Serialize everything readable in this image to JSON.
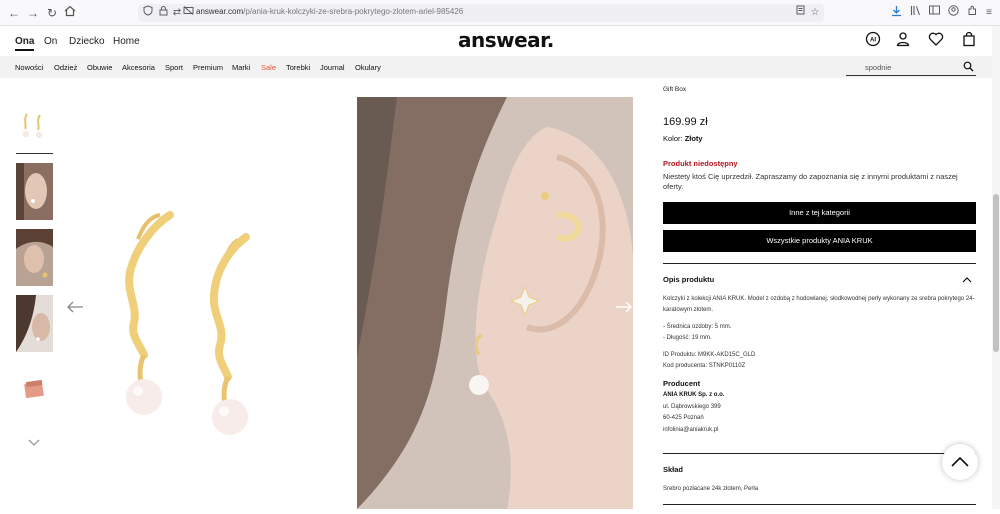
{
  "browser": {
    "url_domain": "answear.com",
    "url_path": "/p/ania-kruk-kolczyki-ze-srebra-pokrytego-zlotem-ariel-985426"
  },
  "header": {
    "gender_tabs": [
      {
        "label": "Ona",
        "active": true
      },
      {
        "label": "On",
        "active": false
      },
      {
        "label": "Dziecko",
        "active": false
      },
      {
        "label": "Home",
        "active": false
      }
    ],
    "logo": "answear.",
    "icons": [
      "ai-assistant-icon",
      "account-icon",
      "wishlist-heart-icon",
      "cart-bag-icon"
    ]
  },
  "categories": [
    {
      "label": "Nowości",
      "sale": false
    },
    {
      "label": "Odzież",
      "sale": false
    },
    {
      "label": "Obuwie",
      "sale": false
    },
    {
      "label": "Akcesoria",
      "sale": false
    },
    {
      "label": "Sport",
      "sale": false
    },
    {
      "label": "Premium",
      "sale": false
    },
    {
      "label": "Marki",
      "sale": false
    },
    {
      "label": "Sale",
      "sale": true
    },
    {
      "label": "Torebki",
      "sale": false
    },
    {
      "label": "Journal",
      "sale": false
    },
    {
      "label": "Okulary",
      "sale": false
    }
  ],
  "search": {
    "placeholder": "spodnie"
  },
  "product": {
    "gift_box": "Gift Box",
    "price": "169.99 zł",
    "color_label": "Kolor:",
    "color_value": "Złoty",
    "unavailable_title": "Produkt niedostępny",
    "unavailable_text": "Niestety ktoś Cię uprzedził. Zapraszamy do zapoznania się z innymi produktami z naszej oferty.",
    "btn_other_category": "Inne z tej kategorii",
    "btn_all_products": "Wszystkie produkty ANIA KRUK"
  },
  "description": {
    "title": "Opis produktu",
    "intro": "Kolczyki z kolekcji ANIA KRUK. Model z ozdobą z hodowlanej, słodkowodnej perły wykonany ze srebra pokrytego 24-karatowym złotem.",
    "spec_1": "- Średnica ozdoby: 5 mm.",
    "spec_2": "- Długość: 19 mm.",
    "id_line": "ID Produktu: M9KK-AKD15C_GLD",
    "code_line": "Kod producenta: STNKP0110Z",
    "producer_title": "Producent",
    "producer_name": "ANIA KRUK Sp. z o.o.",
    "producer_street": "ul. Dąbrowskiego 399",
    "producer_city": "60-425 Poznań",
    "producer_email": "infolinia@aniakruk.pl"
  },
  "composition": {
    "title": "Skład",
    "text": "Srebro pozłacane 24k złotem, Perła"
  },
  "colors": {
    "sale": "#e53",
    "unavailable": "#b0161e",
    "button_bg": "#000000",
    "gold": "#e8c46a"
  }
}
